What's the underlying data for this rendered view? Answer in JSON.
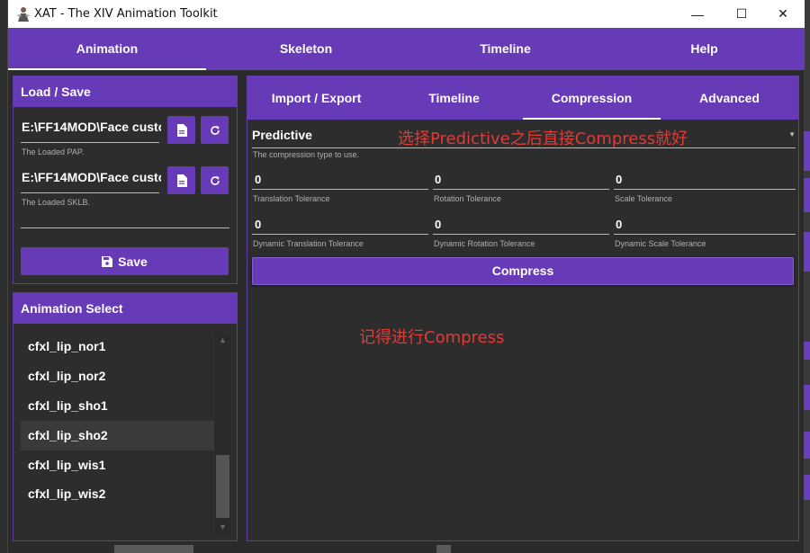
{
  "window": {
    "title": "XAT - The XIV Animation Toolkit",
    "controls": {
      "minimize": "—",
      "maximize": "☐",
      "close": "✕"
    }
  },
  "menu": {
    "tabs": [
      {
        "label": "Animation",
        "active": true
      },
      {
        "label": "Skeleton",
        "active": false
      },
      {
        "label": "Timeline",
        "active": false
      },
      {
        "label": "Help",
        "active": false
      }
    ]
  },
  "load_save": {
    "header": "Load / Save",
    "pap_value": "E:\\FF14MOD\\Face custo",
    "pap_help": "The Loaded PAP.",
    "sklb_value": "E:\\FF14MOD\\Face custo",
    "sklb_help": "The Loaded SKLB.",
    "save_label": "Save"
  },
  "animation_select": {
    "header": "Animation Select",
    "items": [
      {
        "label": "cfxl_lip_nor1",
        "selected": false
      },
      {
        "label": "cfxl_lip_nor2",
        "selected": false
      },
      {
        "label": "cfxl_lip_sho1",
        "selected": false
      },
      {
        "label": "cfxl_lip_sho2",
        "selected": true
      },
      {
        "label": "cfxl_lip_wis1",
        "selected": false
      },
      {
        "label": "cfxl_lip_wis2",
        "selected": false
      }
    ]
  },
  "main": {
    "tabs": [
      {
        "label": "Import / Export",
        "active": false
      },
      {
        "label": "Timeline",
        "active": false
      },
      {
        "label": "Compression",
        "active": true
      },
      {
        "label": "Advanced",
        "active": false
      }
    ],
    "compression_type": {
      "value": "Predictive",
      "help": "The compression type to use."
    },
    "tolerances": [
      {
        "value": "0",
        "label": "Translation Tolerance"
      },
      {
        "value": "0",
        "label": "Rotation Tolerance"
      },
      {
        "value": "0",
        "label": "Scale Tolerance"
      },
      {
        "value": "0",
        "label": "Dynamic Translation Tolerance"
      },
      {
        "value": "0",
        "label": "Dynamic Rotation Tolerance"
      },
      {
        "value": "0",
        "label": "Dynamic Scale Tolerance"
      }
    ],
    "compress_label": "Compress"
  },
  "annotations": {
    "note1": "选择Predictive之后直接Compress就好",
    "note2": "记得进行Compress",
    "color": "#e53935"
  },
  "colors": {
    "accent": "#673ab7",
    "background": "#2b2b2b"
  }
}
